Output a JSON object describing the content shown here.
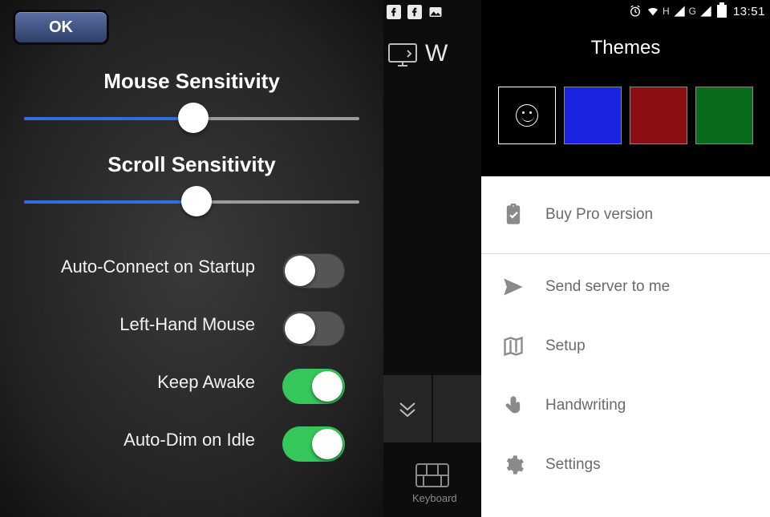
{
  "left_panel": {
    "ok_label": "OK",
    "mouse_sensitivity_label": "Mouse Sensitivity",
    "scroll_sensitivity_label": "Scroll Sensitivity",
    "mouse_sensitivity_value": 50,
    "scroll_sensitivity_value": 51,
    "toggles": {
      "auto_connect": {
        "label": "Auto-Connect on Startup",
        "on": false
      },
      "left_hand": {
        "label": "Left-Hand Mouse",
        "on": false
      },
      "keep_awake": {
        "label": "Keep Awake",
        "on": true
      },
      "auto_dim": {
        "label": "Auto-Dim on Idle",
        "on": true
      }
    }
  },
  "middle_panel": {
    "letter": "W",
    "keyboard_label": "Keyboard"
  },
  "right_panel": {
    "statusbar": {
      "net1": "H",
      "net2": "G",
      "time": "13:51"
    },
    "themes_title": "Themes",
    "swatches": [
      "black",
      "blue",
      "red",
      "green"
    ],
    "menu": {
      "buy_pro": "Buy Pro version",
      "send": "Send server to me",
      "setup": "Setup",
      "hand": "Handwriting",
      "settings": "Settings"
    }
  }
}
